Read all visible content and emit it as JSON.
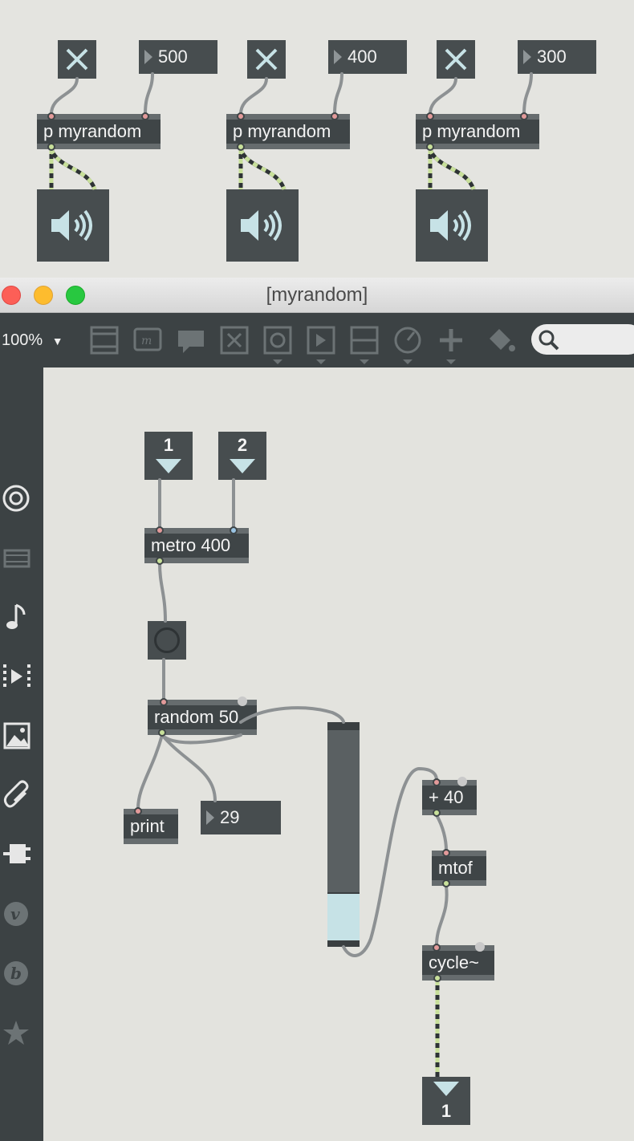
{
  "main_patch": {
    "subpatchers": [
      {
        "object_text": "p myrandom",
        "number_value": "500"
      },
      {
        "object_text": "p myrandom",
        "number_value": "400"
      },
      {
        "object_text": "p myrandom",
        "number_value": "300"
      }
    ]
  },
  "window": {
    "title": "[myrandom]"
  },
  "toolbar": {
    "zoom": "100%",
    "zoom_arrow": "▼",
    "icons": [
      "object-box-icon",
      "message-icon",
      "comment-icon",
      "toggle-icon",
      "button-icon",
      "number-icon",
      "slider-icon",
      "dial-icon",
      "add-icon",
      "paint-bucket-icon",
      "search-icon"
    ]
  },
  "sidebar": {
    "icons": [
      "target-icon",
      "media-icon",
      "music-note-icon",
      "video-icon",
      "image-icon",
      "paperclip-icon",
      "plug-icon",
      "vimeo-icon",
      "bpatcher-icon",
      "star-icon"
    ]
  },
  "sub_patch": {
    "inlet1": "1",
    "inlet2": "2",
    "metro": "metro 400",
    "random": "random 50",
    "print": "print",
    "number_value": "29",
    "plus": "+ 40",
    "mtof": "mtof",
    "cycle": "cycle~",
    "outlet": "1",
    "slider_level": 0.23
  },
  "colors": {
    "object_bg": "#3f4547",
    "accent_ice": "#c7e2e6",
    "signal_wire": "#c8e09a",
    "canvas": "#e3e3de"
  }
}
